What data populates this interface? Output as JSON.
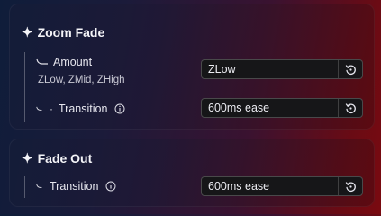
{
  "sections": [
    {
      "title": "Zoom Fade",
      "title_icon": "sparkle-icon",
      "rows": [
        {
          "label": "Amount",
          "description": "ZLow, ZMid, ZHigh",
          "value": "ZLow",
          "reset_icon": "reset-icon"
        },
        {
          "label": "Transition",
          "info_icon": "info-icon",
          "value": "600ms ease",
          "reset_icon": "reset-icon"
        }
      ]
    },
    {
      "title": "Fade Out",
      "title_icon": "sparkle-icon",
      "rows": [
        {
          "label": "Transition",
          "info_icon": "info-icon",
          "value": "600ms ease",
          "reset_icon": "reset-icon"
        }
      ]
    }
  ],
  "colors": {
    "control_bg": "#161618",
    "text": "#e8e8ee",
    "gradient_left": "#0f1d3a",
    "gradient_right": "#7a0a10"
  }
}
